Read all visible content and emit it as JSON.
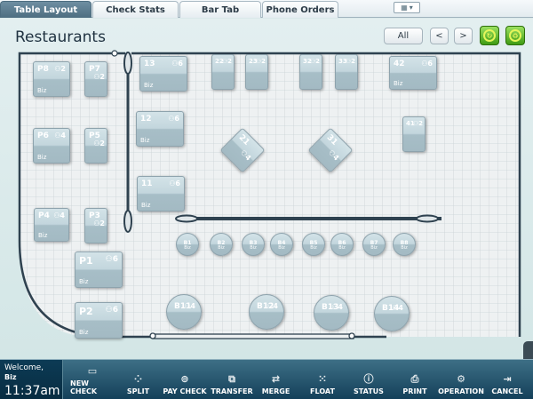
{
  "tabs": [
    {
      "label": "Table Layout",
      "active": true
    },
    {
      "label": "Check Stats",
      "active": false
    },
    {
      "label": "Bar Tab",
      "active": false
    },
    {
      "label": "Phone Orders",
      "active": false
    }
  ],
  "header": {
    "title": "Restaurants",
    "filter_label": "All",
    "prev_label": "<",
    "next_label": ">"
  },
  "tables": [
    {
      "num": "P8",
      "cap": "2",
      "server": "Biz"
    },
    {
      "num": "P7",
      "cap": "2",
      "server": ""
    },
    {
      "num": "P6",
      "cap": "4",
      "server": "Biz"
    },
    {
      "num": "P5",
      "cap": "2",
      "server": ""
    },
    {
      "num": "P4",
      "cap": "4",
      "server": "Biz"
    },
    {
      "num": "P3",
      "cap": "2",
      "server": ""
    },
    {
      "num": "P1",
      "cap": "6",
      "server": "Biz"
    },
    {
      "num": "P2",
      "cap": "6",
      "server": "Biz"
    },
    {
      "num": "13",
      "cap": "6",
      "server": "Biz"
    },
    {
      "num": "12",
      "cap": "6",
      "server": "Biz"
    },
    {
      "num": "11",
      "cap": "6",
      "server": "Biz"
    },
    {
      "num": "22",
      "cap": "2",
      "server": ""
    },
    {
      "num": "23",
      "cap": "2",
      "server": ""
    },
    {
      "num": "32",
      "cap": "2",
      "server": ""
    },
    {
      "num": "33",
      "cap": "2",
      "server": ""
    },
    {
      "num": "42",
      "cap": "6",
      "server": "Biz"
    },
    {
      "num": "41",
      "cap": "2",
      "server": ""
    },
    {
      "num": "21",
      "cap": "4",
      "server": ""
    },
    {
      "num": "31",
      "cap": "4",
      "server": ""
    },
    {
      "num": "B1",
      "cap": "",
      "server": "Biz"
    },
    {
      "num": "B2",
      "cap": "",
      "server": "Biz"
    },
    {
      "num": "B3",
      "cap": "",
      "server": "Biz"
    },
    {
      "num": "B4",
      "cap": "",
      "server": "Biz"
    },
    {
      "num": "B5",
      "cap": "",
      "server": "Biz"
    },
    {
      "num": "B6",
      "cap": "",
      "server": "Biz"
    },
    {
      "num": "B7",
      "cap": "",
      "server": "Biz"
    },
    {
      "num": "B8",
      "cap": "",
      "server": "Biz"
    },
    {
      "num": "B11",
      "cap": "4",
      "server": ""
    },
    {
      "num": "B12",
      "cap": "4",
      "server": ""
    },
    {
      "num": "B13",
      "cap": "4",
      "server": ""
    },
    {
      "num": "B14",
      "cap": "4",
      "server": ""
    }
  ],
  "status": {
    "welcome": "Welcome,",
    "user": "Biz",
    "time": "11:37am"
  },
  "actions": [
    {
      "label": "NEW CHECK",
      "icon": "new-check-icon"
    },
    {
      "label": "SPLIT",
      "icon": "split-icon"
    },
    {
      "label": "PAY CHECK",
      "icon": "pay-check-icon"
    },
    {
      "label": "TRANSFER",
      "icon": "transfer-icon"
    },
    {
      "label": "MERGE",
      "icon": "merge-icon"
    },
    {
      "label": "FLOAT",
      "icon": "float-icon"
    },
    {
      "label": "STATUS",
      "icon": "status-icon"
    },
    {
      "label": "PRINT",
      "icon": "print-icon"
    },
    {
      "label": "OPERATION",
      "icon": "operation-icon"
    },
    {
      "label": "CANCEL",
      "icon": "cancel-icon"
    }
  ],
  "colors": {
    "accent_green": "#3f9b13",
    "bottom_bar": "#14405a",
    "table_fill": "#a7bec7"
  }
}
